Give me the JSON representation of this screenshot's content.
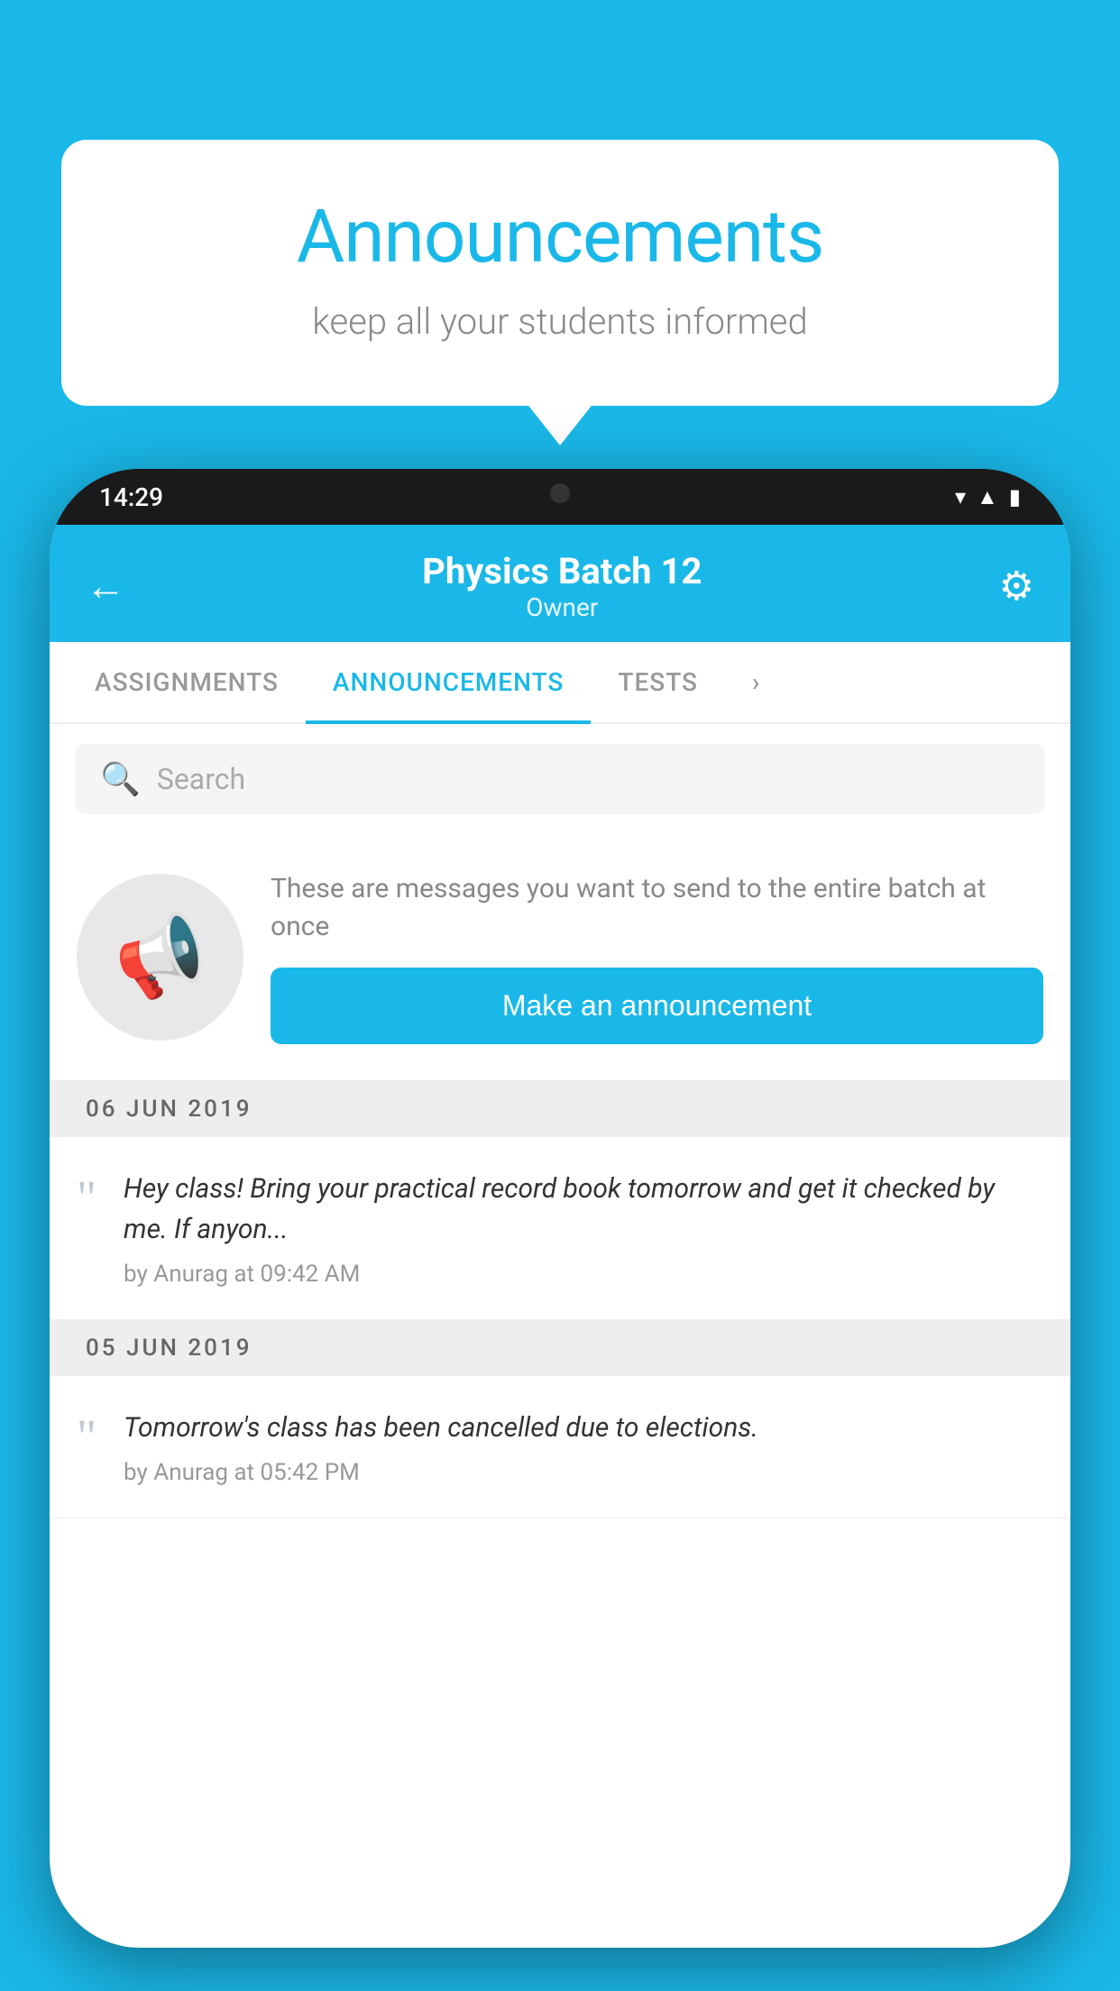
{
  "background_color": "#1ab8e8",
  "speech_bubble": {
    "title": "Announcements",
    "subtitle": "keep all your students informed"
  },
  "phone": {
    "status_bar": {
      "time": "14:29",
      "icons": [
        "wifi",
        "signal",
        "battery"
      ]
    },
    "header": {
      "title": "Physics Batch 12",
      "subtitle": "Owner",
      "back_label": "←",
      "gear_label": "⚙"
    },
    "tabs": [
      {
        "label": "ASSIGNMENTS",
        "active": false
      },
      {
        "label": "ANNOUNCEMENTS",
        "active": true
      },
      {
        "label": "TESTS",
        "active": false
      },
      {
        "label": "›",
        "active": false
      }
    ],
    "search": {
      "placeholder": "Search"
    },
    "promo": {
      "description": "These are messages you want to send to the entire batch at once",
      "button_label": "Make an announcement"
    },
    "announcements": [
      {
        "date": "06  JUN  2019",
        "text": "Hey class! Bring your practical record book tomorrow and get it checked by me. If anyon...",
        "meta": "by Anurag at 09:42 AM"
      },
      {
        "date": "05  JUN  2019",
        "text": "Tomorrow's class has been cancelled due to elections.",
        "meta": "by Anurag at 05:42 PM"
      }
    ]
  }
}
